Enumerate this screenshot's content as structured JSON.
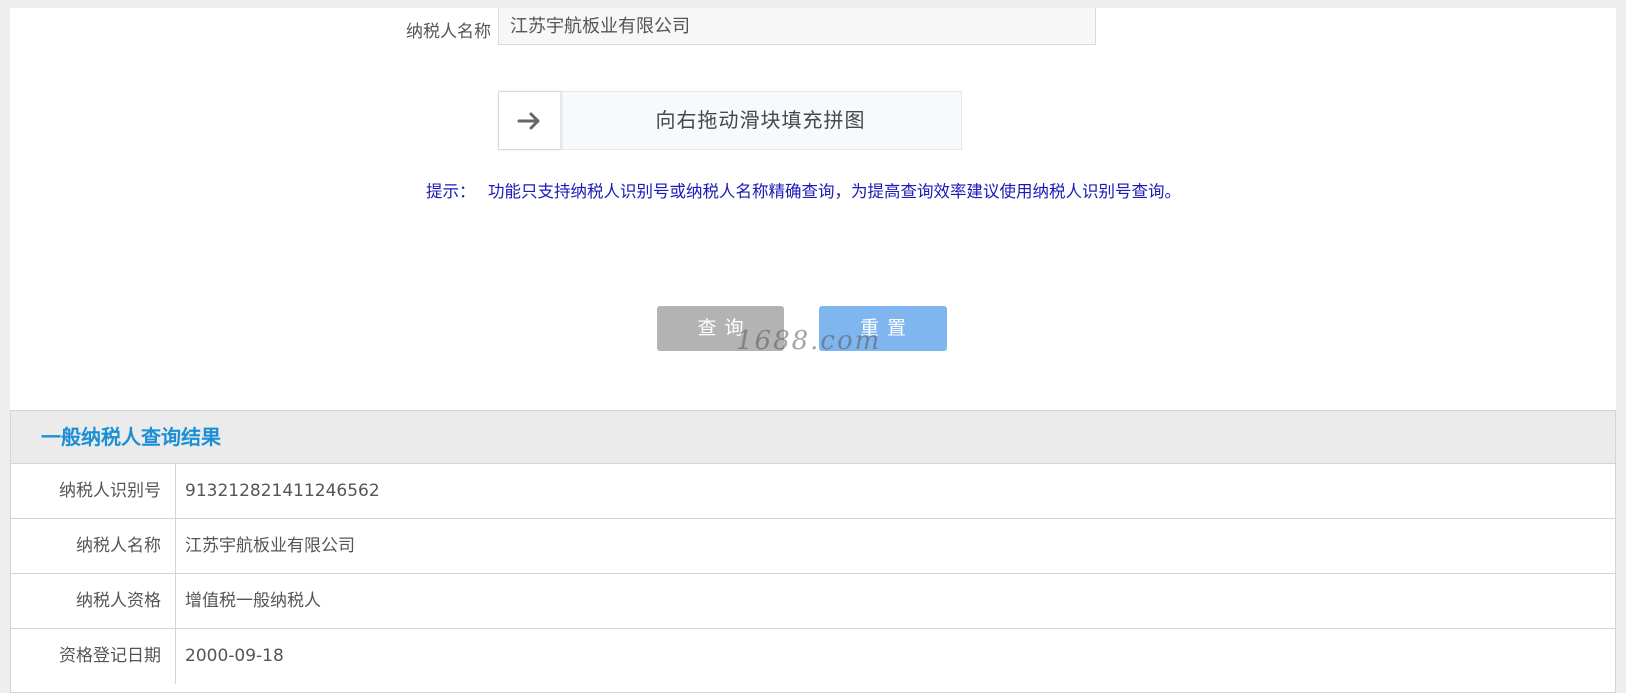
{
  "form": {
    "name_label": "纳税人名称",
    "name_value": "江苏宇航板业有限公司"
  },
  "slider": {
    "text": "向右拖动滑块填充拼图",
    "knob_icon": "arrow-right-icon"
  },
  "hint": {
    "label": "提示：",
    "text": "功能只支持纳税人识别号或纳税人名称精确查询，为提高查询效率建议使用纳税人识别号查询。"
  },
  "buttons": {
    "query": "查询",
    "reset": "重置"
  },
  "watermark": "1688.com",
  "result": {
    "title": "一般纳税人查询结果",
    "rows": [
      {
        "label": "纳税人识别号",
        "value": "913212821411246562"
      },
      {
        "label": "纳税人名称",
        "value": "江苏宇航板业有限公司"
      },
      {
        "label": "纳税人资格",
        "value": "增值税一般纳税人"
      },
      {
        "label": "资格登记日期",
        "value": "2000-09-18"
      }
    ]
  },
  "colors": {
    "page_bg": "#eeeeee",
    "hint": "#1a1ab8",
    "result_title": "#1b8fd6",
    "query_button": "#b3b3b3",
    "reset_button": "#7fb6ef"
  }
}
